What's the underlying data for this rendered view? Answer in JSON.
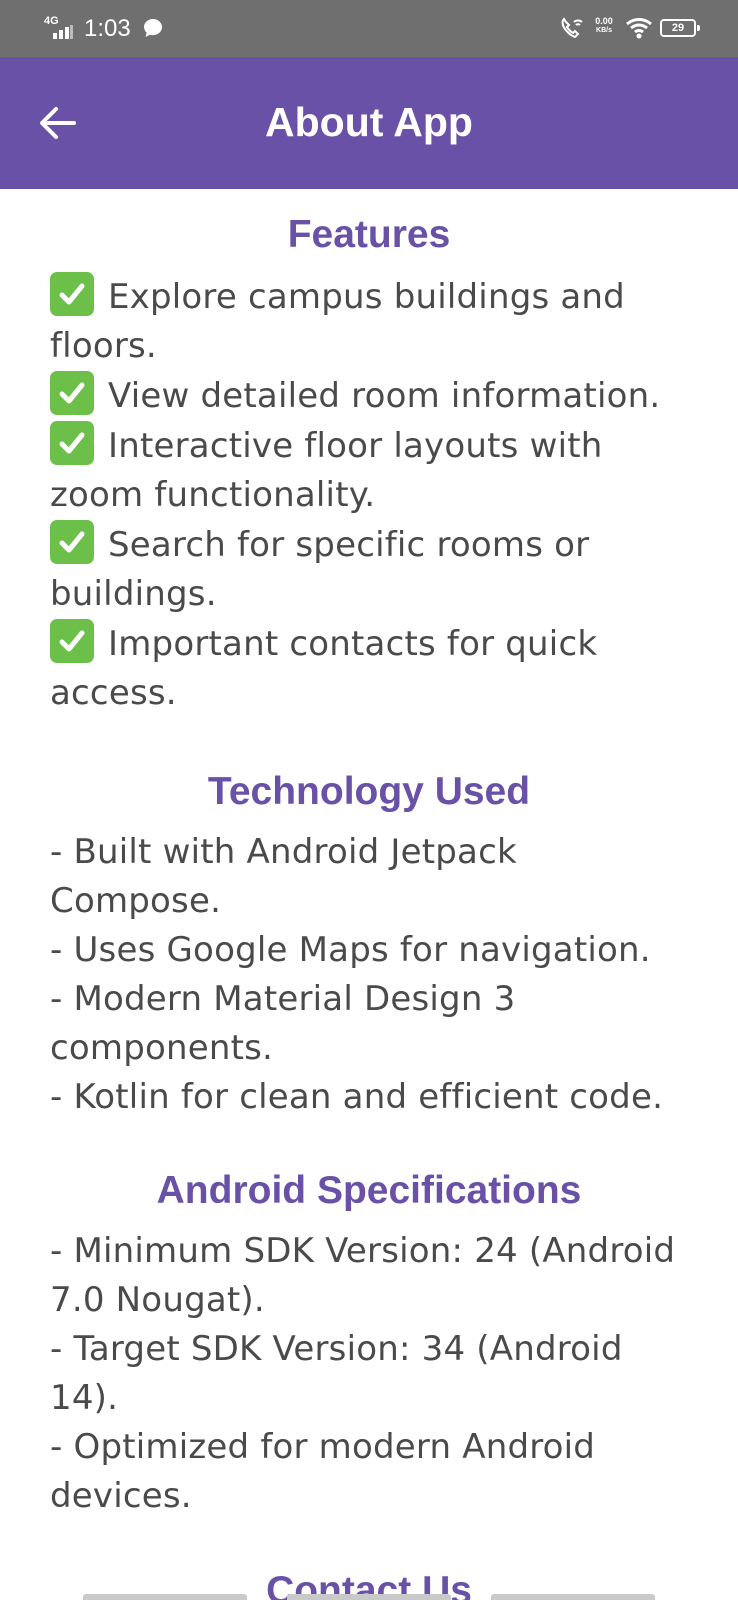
{
  "status_bar": {
    "network": "4G",
    "time": "1:03",
    "speed_value": "0.00",
    "speed_unit": "KB/s",
    "battery": "29"
  },
  "app_bar": {
    "title": "About App",
    "back_icon": "arrow-left-icon",
    "color": "#6a51a8"
  },
  "sections": {
    "features": {
      "title": "Features",
      "items": [
        "Explore campus buildings and floors.",
        "View detailed room information.",
        "Interactive floor layouts with zoom functionality.",
        "Search for specific rooms or buildings.",
        "Important contacts for quick access."
      ]
    },
    "technology": {
      "title": "Technology Used",
      "items": [
        "- Built with Android Jetpack Compose.",
        "- Uses Google Maps for navigation.",
        "- Modern Material Design 3 components.",
        "- Kotlin for clean and efficient code."
      ]
    },
    "android": {
      "title": "Android Specifications",
      "items": [
        "- Minimum SDK Version: 24 (Android 7.0 Nougat).",
        "- Target SDK Version: 34 (Android 14).",
        "- Optimized for modern Android devices."
      ]
    },
    "contact": {
      "title": "Contact Us"
    }
  },
  "colors": {
    "accent": "#6a51a8",
    "text": "#4a4a4a",
    "check": "#6cc04a"
  }
}
